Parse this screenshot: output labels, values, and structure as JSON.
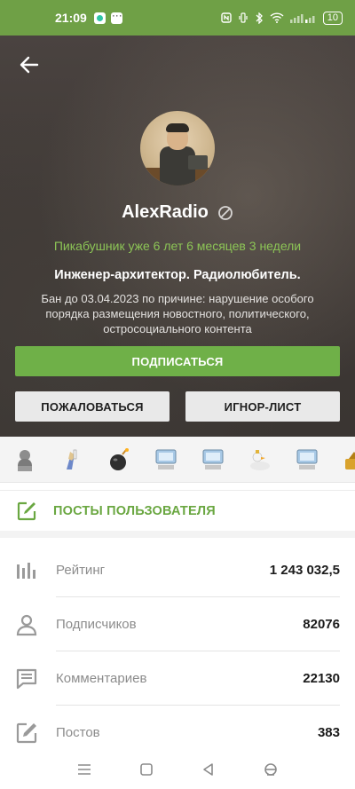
{
  "status_bar": {
    "time": "21:09",
    "battery": "10"
  },
  "profile": {
    "username": "AlexRadio",
    "tenure": "Пикабушник уже 6 лет 6 месяцев 3 недели",
    "bio": "Инженер-архитектор. Радиолюбитель.",
    "ban_notice": "Бан до 03.04.2023 по причине: нарушение особого порядка размещения новостного, политического, остросоциального контента"
  },
  "actions": {
    "subscribe": "ПОДПИСАТЬСЯ",
    "report": "ПОЖАЛОВАТЬСЯ",
    "ignore": "ИГНОР-ЛИСТ"
  },
  "awards": [
    "award-bust-icon",
    "award-hand-icon",
    "award-bomb-icon",
    "award-computer-icon",
    "award-computer-icon",
    "award-duck-icon",
    "award-computer-icon",
    "award-gold-icon"
  ],
  "posts_link": {
    "label": "ПОСТЫ ПОЛЬЗОВАТЕЛЯ"
  },
  "stats": [
    {
      "icon": "rating-bars-icon",
      "label": "Рейтинг",
      "value": "1 243 032,5"
    },
    {
      "icon": "subscribers-person-icon",
      "label": "Подписчиков",
      "value": "82076"
    },
    {
      "icon": "comments-bubble-icon",
      "label": "Комментариев",
      "value": "22130"
    },
    {
      "icon": "posts-edit-icon",
      "label": "Постов",
      "value": "383"
    }
  ],
  "colors": {
    "accent_green": "#6fb048",
    "status_bar_green": "#6fa046",
    "tenure_green": "#8cc456",
    "header_dark": "#3e3835"
  }
}
